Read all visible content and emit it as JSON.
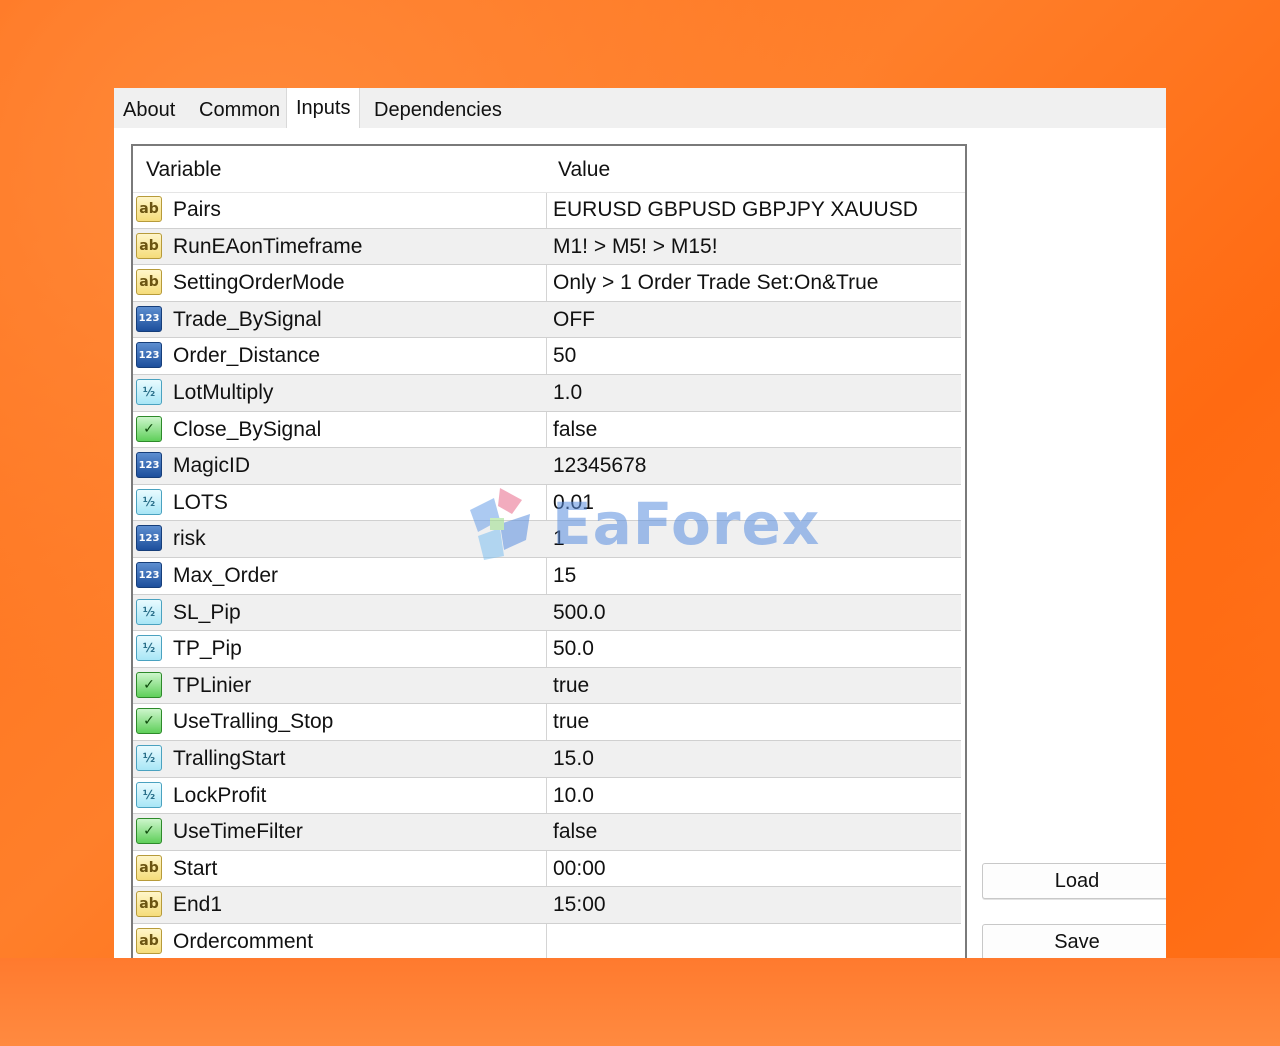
{
  "tabs": [
    {
      "label": "About"
    },
    {
      "label": "Common"
    },
    {
      "label": "Inputs"
    },
    {
      "label": "Dependencies"
    }
  ],
  "active_tab": "Inputs",
  "table": {
    "headers": {
      "variable": "Variable",
      "value": "Value"
    },
    "rows": [
      {
        "name": "Pairs",
        "value": "EURUSD GBPUSD GBPJPY XAUUSD",
        "icon": "string-icon",
        "glyph": "ab"
      },
      {
        "name": "RunEAonTimeframe",
        "value": "M1! > M5! > M15!",
        "icon": "string-icon",
        "glyph": "ab"
      },
      {
        "name": "SettingOrderMode",
        "value": "Only > 1 Order Trade Set:On&True",
        "icon": "string-icon",
        "glyph": "ab"
      },
      {
        "name": "Trade_BySignal",
        "value": "OFF",
        "icon": "integer-icon",
        "glyph": "123"
      },
      {
        "name": "Order_Distance",
        "value": "50",
        "icon": "integer-icon",
        "glyph": "123"
      },
      {
        "name": "LotMultiply",
        "value": "1.0",
        "icon": "double-icon",
        "glyph": "½"
      },
      {
        "name": "Close_BySignal",
        "value": "false",
        "icon": "bool-icon",
        "glyph": "✓"
      },
      {
        "name": "MagicID",
        "value": "12345678",
        "icon": "integer-icon",
        "glyph": "123"
      },
      {
        "name": "LOTS",
        "value": "0.01",
        "icon": "double-icon",
        "glyph": "½"
      },
      {
        "name": "risk",
        "value": "1",
        "icon": "integer-icon",
        "glyph": "123"
      },
      {
        "name": "Max_Order",
        "value": "15",
        "icon": "integer-icon",
        "glyph": "123"
      },
      {
        "name": "SL_Pip",
        "value": "500.0",
        "icon": "double-icon",
        "glyph": "½"
      },
      {
        "name": "TP_Pip",
        "value": "50.0",
        "icon": "double-icon",
        "glyph": "½"
      },
      {
        "name": "TPLinier",
        "value": "true",
        "icon": "bool-icon",
        "glyph": "✓"
      },
      {
        "name": "UseTralling_Stop",
        "value": "true",
        "icon": "bool-icon",
        "glyph": "✓"
      },
      {
        "name": "TrallingStart",
        "value": "15.0",
        "icon": "double-icon",
        "glyph": "½"
      },
      {
        "name": "LockProfit",
        "value": "10.0",
        "icon": "double-icon",
        "glyph": "½"
      },
      {
        "name": "UseTimeFilter",
        "value": "false",
        "icon": "bool-icon",
        "glyph": "✓"
      },
      {
        "name": "Start",
        "value": "00:00",
        "icon": "string-icon",
        "glyph": "ab"
      },
      {
        "name": "End1",
        "value": "15:00",
        "icon": "string-icon",
        "glyph": "ab"
      },
      {
        "name": "Ordercomment",
        "value": "",
        "icon": "string-icon",
        "glyph": "ab"
      }
    ]
  },
  "buttons": {
    "load": "Load",
    "save": "Save"
  },
  "watermark": "EaForex"
}
